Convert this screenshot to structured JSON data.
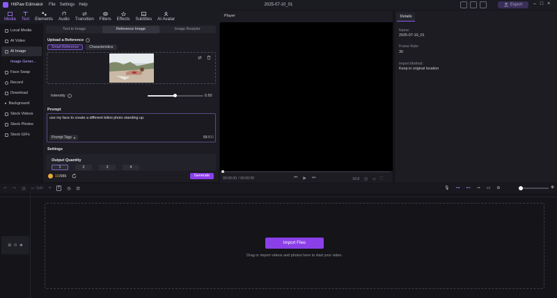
{
  "app": {
    "name": "HitPaw Edimakor",
    "menu": [
      "File",
      "Settings",
      "Help"
    ],
    "project_title": "2025-07-10_01",
    "export_label": "Export"
  },
  "toolbar_tabs": [
    {
      "label": "Media",
      "icon": "media-icon"
    },
    {
      "label": "Text",
      "icon": "text-icon"
    },
    {
      "label": "Elements",
      "icon": "elements-icon"
    },
    {
      "label": "Audio",
      "icon": "audio-icon"
    },
    {
      "label": "Transition",
      "icon": "transition-icon"
    },
    {
      "label": "Filters",
      "icon": "filters-icon"
    },
    {
      "label": "Effects",
      "icon": "effects-icon"
    },
    {
      "label": "Subtitles",
      "icon": "subtitles-icon"
    },
    {
      "label": "AI Avatar",
      "icon": "ai-avatar-icon"
    }
  ],
  "sidebar": {
    "items": [
      {
        "label": "Local Media"
      },
      {
        "label": "AI Video"
      },
      {
        "label": "AI Image"
      },
      {
        "label": "Image Gener..."
      },
      {
        "label": "Face Swap"
      },
      {
        "label": "Record"
      },
      {
        "label": "Download"
      },
      {
        "label": "Background"
      },
      {
        "label": "Stock Videos"
      },
      {
        "label": "Stock Photos"
      },
      {
        "label": "Stock GIFs"
      }
    ]
  },
  "ai_image": {
    "subtabs": [
      "Text to Image",
      "Reference Image",
      "Image Restyler"
    ],
    "upload_label": "Upload a Reference",
    "ref_modes": [
      "Smart Reference",
      "Characteristics"
    ],
    "intensity_label": "Intensity",
    "intensity_value": "0.50",
    "intensity_fraction": 0.5,
    "prompt_label": "Prompt",
    "prompt_text": "use my face to create a different bikini photo standing up.",
    "prompt_tags_label": "Prompt Tags",
    "char_count": "59",
    "char_max": "/800",
    "settings_label": "Settings",
    "output_quantity_label": "Output Quantity",
    "quantity_options": [
      "1",
      "2",
      "3",
      "4"
    ],
    "credits": "10",
    "credits_total": "/986",
    "generate_label": "Generate"
  },
  "player": {
    "title": "Player",
    "time_current": "00:00:00",
    "time_total": "/ 00:00:00",
    "aspect": "16:9"
  },
  "details": {
    "tab": "Details",
    "name_key": "Name:",
    "name_value": "2025-07-10_01",
    "frame_key": "Frame Rate:",
    "frame_value": "30",
    "import_key": "Import Method:",
    "import_value": "Keep in original location"
  },
  "timeline": {
    "split_label": "Split",
    "import_files_label": "Import Files",
    "drop_hint": "Drag or import videos and photos here to start your video."
  },
  "colors": {
    "accent": "#8b3fe8",
    "active_tab": "#b07dff",
    "background": "#141419"
  }
}
